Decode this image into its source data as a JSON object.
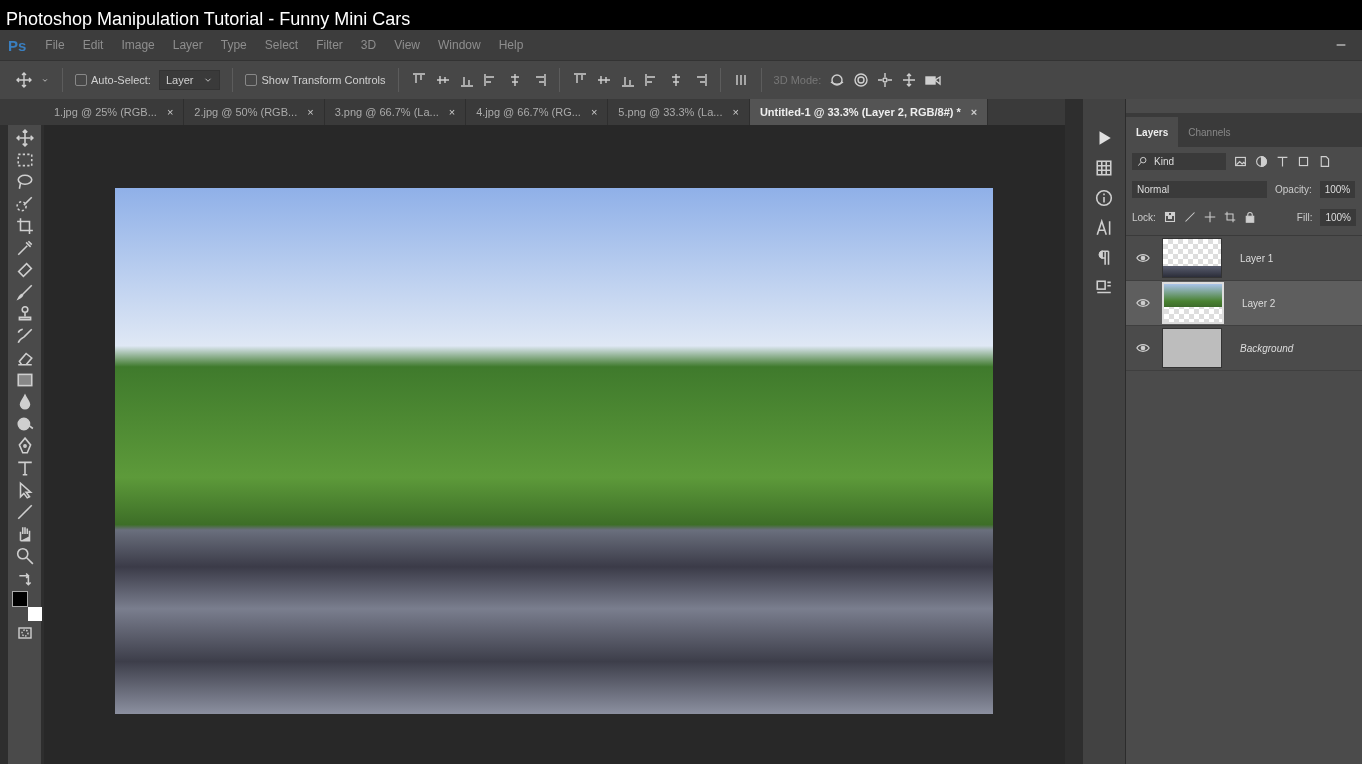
{
  "video_title": "Photoshop Manipulation Tutorial - Funny Mini Cars",
  "app_logo": "Ps",
  "menu": [
    "File",
    "Edit",
    "Image",
    "Layer",
    "Type",
    "Select",
    "Filter",
    "3D",
    "View",
    "Window",
    "Help"
  ],
  "options_bar": {
    "auto_select": {
      "label": "Auto-Select:",
      "checked": false
    },
    "auto_select_target": "Layer",
    "show_transform": {
      "label": "Show Transform Controls",
      "checked": false
    },
    "mode_3d_label": "3D Mode:"
  },
  "tabs": [
    {
      "label": "1.jpg @ 25% (RGB...",
      "close": "×",
      "selected": false
    },
    {
      "label": "2.jpg @ 50% (RGB...",
      "close": "×",
      "selected": false
    },
    {
      "label": "3.png @ 66.7% (La...",
      "close": "×",
      "selected": false
    },
    {
      "label": "4.jpg @ 66.7% (RG...",
      "close": "×",
      "selected": false
    },
    {
      "label": "5.png @ 33.3% (La...",
      "close": "×",
      "selected": false
    },
    {
      "label": "Untitled-1 @ 33.3% (Layer 2, RGB/8#) *",
      "close": "×",
      "selected": true
    }
  ],
  "panel_tabs": [
    {
      "label": "Layers",
      "selected": true
    },
    {
      "label": "Channels",
      "selected": false
    }
  ],
  "layers_panel": {
    "filter": "Kind",
    "blend_mode": "Normal",
    "opacity_label": "Opacity:",
    "opacity": "100%",
    "lock_label": "Lock:",
    "fill_label": "Fill:",
    "fill": "100%"
  },
  "layers": [
    {
      "name": "Layer 1",
      "kind": "road",
      "visible": true,
      "selected": false
    },
    {
      "name": "Layer 2",
      "kind": "landscape",
      "visible": true,
      "selected": true
    },
    {
      "name": "Background",
      "kind": "background",
      "visible": true,
      "selected": false
    }
  ]
}
